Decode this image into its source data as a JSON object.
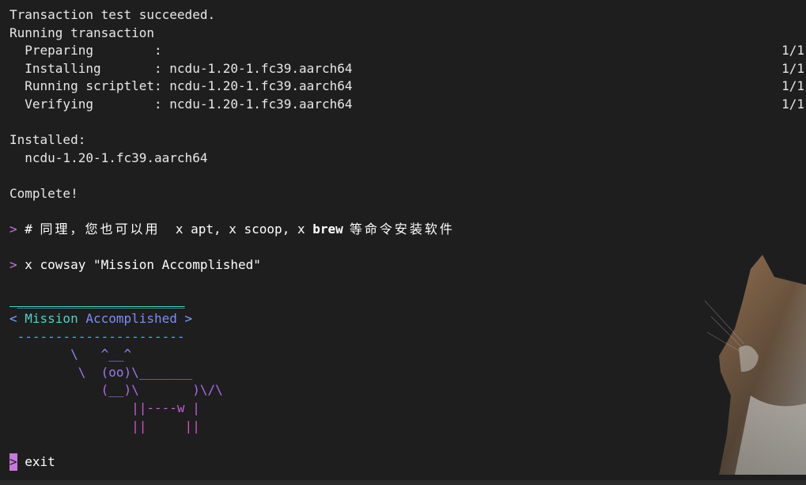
{
  "terminal": {
    "lines": {
      "l1": "Transaction test succeeded.",
      "l2": "Running transaction",
      "l3_label": "  Preparing        :",
      "l3_count": "1/1",
      "l4_label": "  Installing       : ncdu-1.20-1.fc39.aarch64",
      "l4_count": "1/1",
      "l5_label": "  Running scriptlet: ncdu-1.20-1.fc39.aarch64",
      "l5_count": "1/1",
      "l6_label": "  Verifying        : ncdu-1.20-1.fc39.aarch64",
      "l6_count": "1/1",
      "l7": "",
      "l8": "Installed:",
      "l9": "  ncdu-1.20-1.fc39.aarch64",
      "l10": "",
      "l11": "Complete!",
      "l12": "",
      "l13_prompt": ">",
      "l13_text_a": " # ",
      "l13_cjk_a": "同理，您也可以用",
      "l13_text_b": "  x apt, x scoop, x ",
      "l13_bold": "brew",
      "l13_cjk_b": " 等命令安装软件",
      "l14": "",
      "l15_prompt": ">",
      "l15_text": " x cowsay \"Mission Accomplished\"",
      "l16": ""
    },
    "cowsay": {
      "bubble_top": " ______________________",
      "bubble_lt": "< ",
      "bubble_msg_a": "Mission ",
      "bubble_msg_b": "Accomplished",
      "bubble_gt": " >",
      "bubble_bottom": " ----------------------",
      "cow_1": "        \\   ^__^",
      "cow_2": "         \\  (oo)\\_______",
      "cow_3": "            (__)\\       )\\/\\",
      "cow_4": "                ||----w |",
      "cow_5": "                ||     ||"
    },
    "final_prompt": {
      "cursor": ">",
      "text": " exit"
    }
  },
  "colors": {
    "background": "#1e1e1e",
    "foreground": "#e8e8e8",
    "prompt": "#c678dd"
  }
}
